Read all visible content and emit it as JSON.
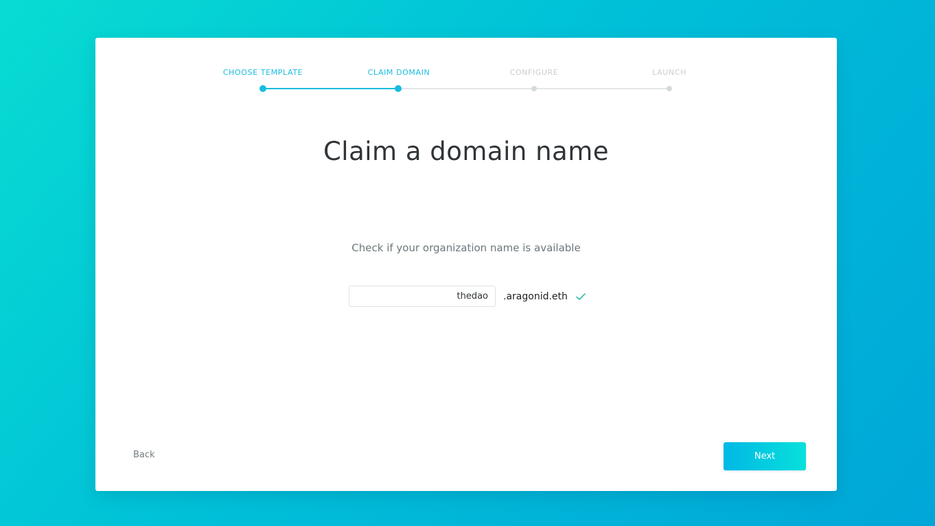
{
  "stepper": {
    "steps": [
      {
        "label": "CHOOSE TEMPLATE",
        "state": "done"
      },
      {
        "label": "CLAIM DOMAIN",
        "state": "active"
      },
      {
        "label": "CONFIGURE",
        "state": "pending"
      },
      {
        "label": "LAUNCH",
        "state": "pending"
      }
    ]
  },
  "main": {
    "title": "Claim a domain name",
    "subtitle": "Check if your organization name is available",
    "domain_input_value": "thedao",
    "domain_suffix": ".aragonid.eth",
    "availability_icon": "check-icon",
    "availability_status": "available"
  },
  "footer": {
    "back_label": "Back",
    "next_label": "Next"
  },
  "colors": {
    "accent": "#18bde0",
    "check": "#2cc0a2",
    "inactive": "#d6dadd"
  }
}
